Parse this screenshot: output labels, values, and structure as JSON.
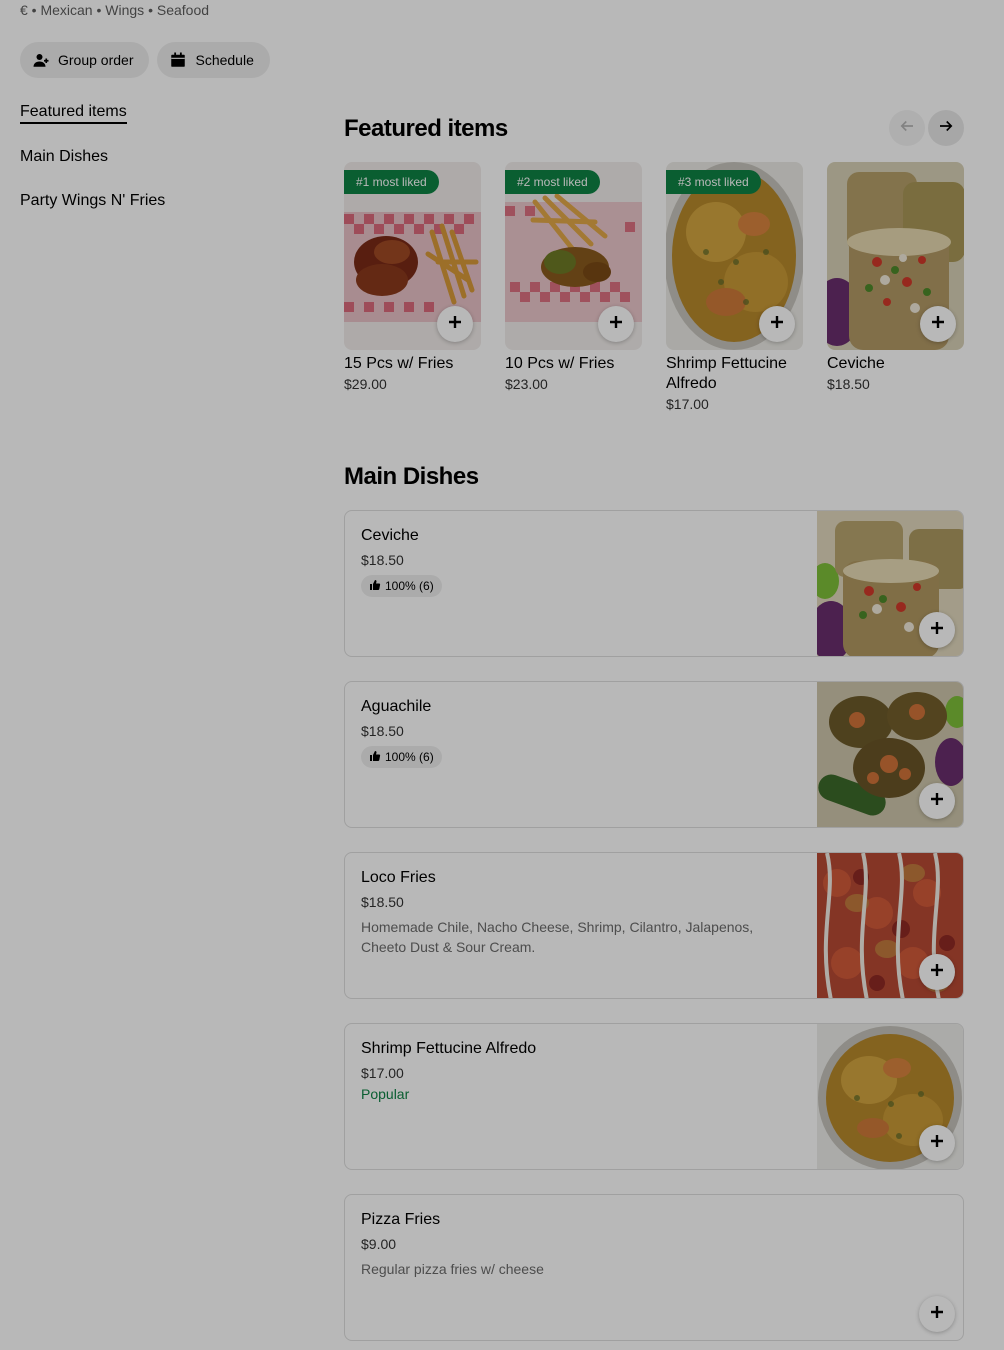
{
  "store": {
    "meta": "€ • Mexican • Wings • Seafood"
  },
  "actions": {
    "group_order": "Group order",
    "schedule": "Schedule"
  },
  "nav": {
    "items": [
      {
        "label": "Featured items",
        "active": true
      },
      {
        "label": "Main Dishes",
        "active": false
      },
      {
        "label": "Party Wings N' Fries",
        "active": false
      }
    ]
  },
  "featured": {
    "title": "Featured items",
    "items": [
      {
        "badge": "#1 most liked",
        "name": "15 Pcs w/ Fries",
        "price": "$29.00",
        "image": "wings-and-fries-photo"
      },
      {
        "badge": "#2 most liked",
        "name": "10 Pcs w/ Fries",
        "price": "$23.00",
        "image": "wings-and-fries-photo"
      },
      {
        "badge": "#3 most liked",
        "name": "Shrimp Fettucine Alfredo",
        "price": "$17.00",
        "image": "shrimp-alfredo-photo"
      },
      {
        "badge": "",
        "name": "Ceviche",
        "price": "$18.50",
        "image": "ceviche-photo"
      }
    ]
  },
  "main": {
    "title": "Main Dishes",
    "items": [
      {
        "name": "Ceviche",
        "price": "$18.50",
        "rating": "100% (6)"
      },
      {
        "name": "Aguachile",
        "price": "$18.50",
        "rating": "100% (6)"
      },
      {
        "name": "Loco Fries",
        "price": "$18.50",
        "description": "Homemade Chile, Nacho Cheese, Shrimp, Cilantro, Jalapenos, Cheeto Dust & Sour Cream."
      },
      {
        "name": "Shrimp Fettucine Alfredo",
        "price": "$17.00",
        "tag": "Popular"
      },
      {
        "name": "Pizza Fries",
        "price": "$9.00",
        "description": "Regular pizza fries w/ cheese"
      }
    ]
  },
  "colors": {
    "accent_green": "#0e8345",
    "pill_bg": "#eeeeee",
    "overlay": "rgba(0,0,0,0.28)"
  },
  "icons": {
    "group_order": "person-add-icon",
    "schedule": "calendar-icon",
    "prev": "arrow-left-icon",
    "next": "arrow-right-icon",
    "add": "plus-icon",
    "rating": "thumbs-up-icon"
  }
}
